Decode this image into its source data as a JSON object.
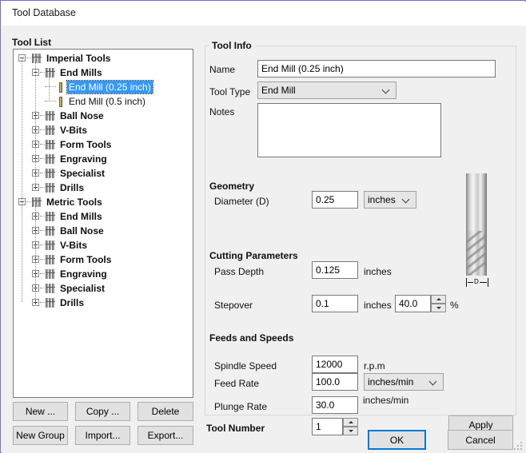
{
  "window": {
    "title": "Tool Database"
  },
  "tool_list": {
    "label": "Tool List",
    "tree": [
      {
        "label": "Imperial Tools",
        "depth": 0,
        "type": "group",
        "expanded": true
      },
      {
        "label": "End Mills",
        "depth": 1,
        "type": "group",
        "expanded": true
      },
      {
        "label": "End Mill (0.25 inch)",
        "depth": 2,
        "type": "tool",
        "selected": true
      },
      {
        "label": "End Mill (0.5 inch)",
        "depth": 2,
        "type": "tool",
        "selected": false
      },
      {
        "label": "Ball Nose",
        "depth": 1,
        "type": "group",
        "expanded": false
      },
      {
        "label": "V-Bits",
        "depth": 1,
        "type": "group",
        "expanded": false
      },
      {
        "label": "Form Tools",
        "depth": 1,
        "type": "group",
        "expanded": false
      },
      {
        "label": "Engraving",
        "depth": 1,
        "type": "group",
        "expanded": false
      },
      {
        "label": "Specialist",
        "depth": 1,
        "type": "group",
        "expanded": false
      },
      {
        "label": "Drills",
        "depth": 1,
        "type": "group",
        "expanded": false
      },
      {
        "label": "Metric Tools",
        "depth": 0,
        "type": "group",
        "expanded": true
      },
      {
        "label": "End Mills",
        "depth": 1,
        "type": "group",
        "expanded": false
      },
      {
        "label": "Ball Nose",
        "depth": 1,
        "type": "group",
        "expanded": false
      },
      {
        "label": "V-Bits",
        "depth": 1,
        "type": "group",
        "expanded": false
      },
      {
        "label": "Form Tools",
        "depth": 1,
        "type": "group",
        "expanded": false
      },
      {
        "label": "Engraving",
        "depth": 1,
        "type": "group",
        "expanded": false
      },
      {
        "label": "Specialist",
        "depth": 1,
        "type": "group",
        "expanded": false
      },
      {
        "label": "Drills",
        "depth": 1,
        "type": "group",
        "expanded": false
      }
    ],
    "buttons": {
      "new": "New ...",
      "copy": "Copy ...",
      "delete": "Delete",
      "new_group": "New Group",
      "import": "Import...",
      "export": "Export..."
    }
  },
  "tool_info": {
    "group_label": "Tool Info",
    "name_label": "Name",
    "name_value": "End Mill (0.25 inch)",
    "tool_type_label": "Tool Type",
    "tool_type_value": "End Mill",
    "notes_label": "Notes",
    "notes_value": ""
  },
  "geometry": {
    "group_label": "Geometry",
    "diameter_label": "Diameter (D)",
    "diameter_value": "0.25",
    "diameter_units": "inches"
  },
  "cutting_parameters": {
    "group_label": "Cutting Parameters",
    "pass_depth_label": "Pass Depth",
    "pass_depth_value": "0.125",
    "pass_depth_units": "inches",
    "stepover_label": "Stepover",
    "stepover_value": "0.1",
    "stepover_units": "inches",
    "stepover_percent_value": "40.0",
    "stepover_percent_units": "%"
  },
  "feeds_and_speeds": {
    "group_label": "Feeds and Speeds",
    "spindle_speed_label": "Spindle Speed",
    "spindle_speed_value": "12000",
    "spindle_speed_units": "r.p.m",
    "feed_rate_label": "Feed Rate",
    "feed_rate_value": "100.0",
    "feed_rate_units": "inches/min",
    "plunge_rate_label": "Plunge Rate",
    "plunge_rate_value": "30.0",
    "plunge_rate_units": "inches/min"
  },
  "tool_number": {
    "label": "Tool Number",
    "value": "1"
  },
  "actions": {
    "apply": "Apply",
    "ok": "OK",
    "cancel": "Cancel"
  },
  "illustration": {
    "dimension_label": "D"
  }
}
